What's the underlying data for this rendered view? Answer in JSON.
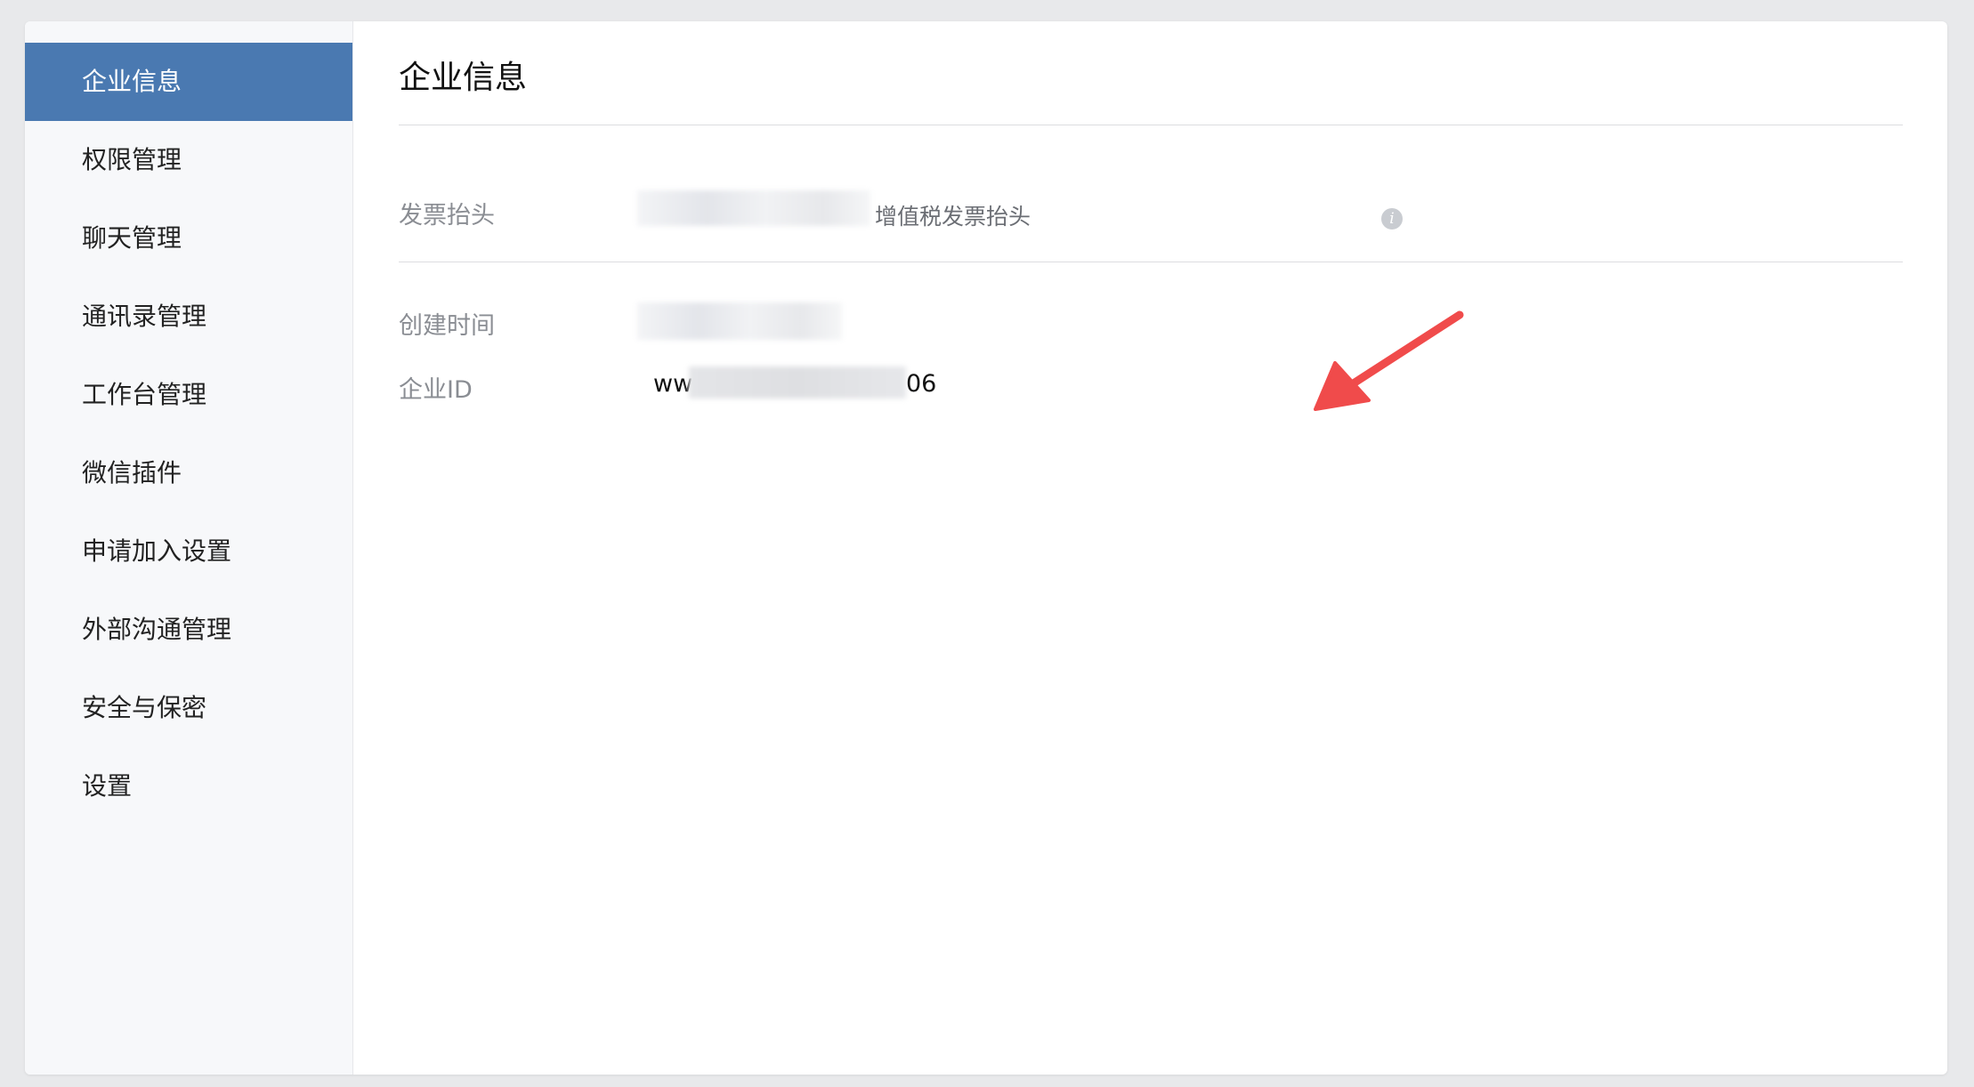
{
  "sidebar": {
    "items": [
      {
        "label": "企业信息",
        "active": true
      },
      {
        "label": "权限管理",
        "active": false
      },
      {
        "label": "聊天管理",
        "active": false
      },
      {
        "label": "通讯录管理",
        "active": false
      },
      {
        "label": "工作台管理",
        "active": false
      },
      {
        "label": "微信插件",
        "active": false
      },
      {
        "label": "申请加入设置",
        "active": false
      },
      {
        "label": "外部沟通管理",
        "active": false
      },
      {
        "label": "安全与保密",
        "active": false
      },
      {
        "label": "设置",
        "active": false
      }
    ]
  },
  "main": {
    "title": "企业信息",
    "invoice": {
      "label": "发票抬头",
      "value_suffix": "增值税发票抬头",
      "icon": "info-icon"
    },
    "created": {
      "label": "创建时间"
    },
    "corp_id": {
      "label": "企业ID",
      "value_prefix": "ww",
      "value_suffix": "06"
    }
  },
  "colors": {
    "accent": "#4a79b1",
    "arrow": "#f04b4b",
    "label": "#8a8d93"
  }
}
